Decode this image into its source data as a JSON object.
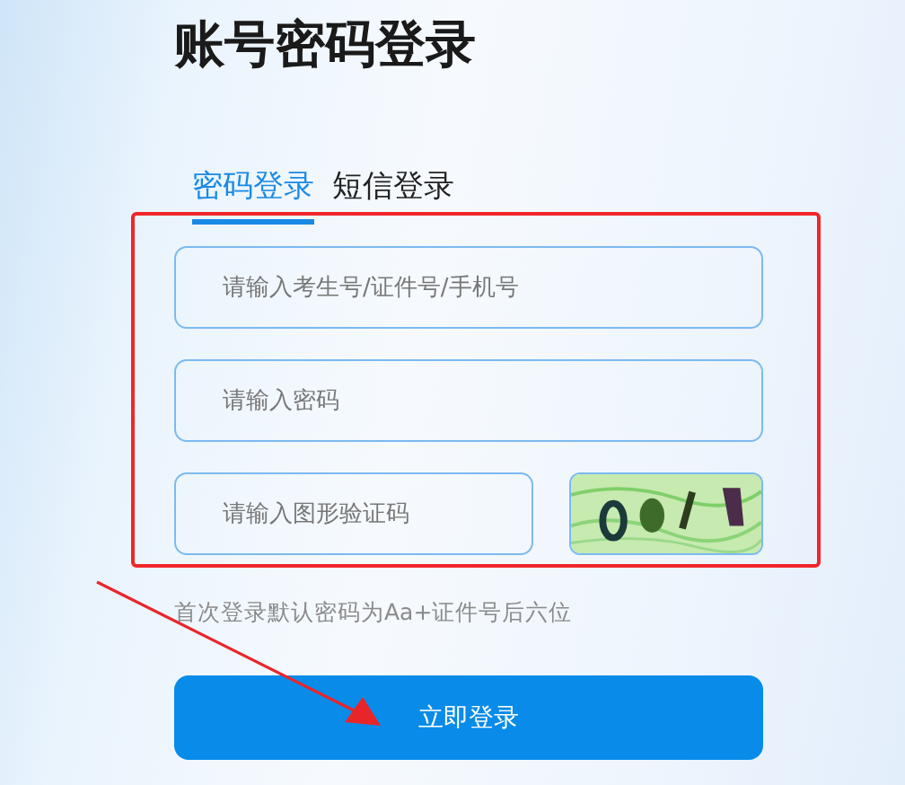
{
  "title": "账号密码登录",
  "tabs": [
    {
      "label": "密码登录",
      "selected": true
    },
    {
      "label": "短信登录",
      "selected": false
    }
  ],
  "fields": [
    {
      "kind": "text",
      "placeholder": "请输入考生号/证件号/手机号"
    },
    {
      "kind": "password",
      "placeholder": "请输入密码"
    },
    {
      "kind": "captcha",
      "placeholder": "请输入图形验证码"
    }
  ],
  "hint": "首次登录默认密码为Aa+证件号后六位",
  "button": "立即登录",
  "highlight_frame": true,
  "arrow": true
}
